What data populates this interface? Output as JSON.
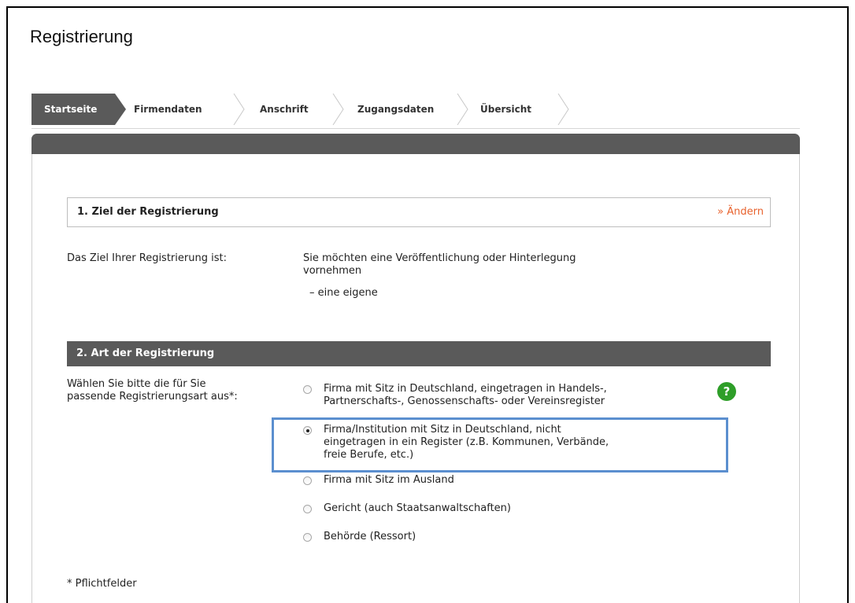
{
  "page": {
    "title": "Registrierung"
  },
  "steps": [
    {
      "label": "Startseite",
      "active": true
    },
    {
      "label": "Firmendaten",
      "active": false
    },
    {
      "label": "Anschrift",
      "active": false
    },
    {
      "label": "Zugangsdaten",
      "active": false
    },
    {
      "label": "Übersicht",
      "active": false
    }
  ],
  "section1": {
    "title": "1. Ziel der Registrierung",
    "change_label": "» Ändern",
    "goal_label": "Das Ziel Ihrer Registrierung ist:",
    "goal_value_line1": "Sie möchten eine Veröffentlichung oder Hinterlegung",
    "goal_value_line2": "vornehmen",
    "goal_sub": "– eine eigene"
  },
  "section2": {
    "title": "2. Art der Registrierung",
    "prompt_line1": "Wählen Sie bitte die für Sie",
    "prompt_line2": "passende Registrierungsart aus*:",
    "options": [
      {
        "lines": [
          "Firma mit Sitz in Deutschland, eingetragen in Handels-,",
          "Partnerschafts-, Genossenschafts- oder Vereinsregister"
        ],
        "selected": false
      },
      {
        "lines": [
          "Firma/Institution mit Sitz in Deutschland, nicht",
          "eingetragen in ein Register (z.B. Kommunen, Verbände,",
          "freie Berufe, etc.)"
        ],
        "selected": true
      },
      {
        "lines": [
          "Firma mit Sitz im Ausland"
        ],
        "selected": false
      },
      {
        "lines": [
          "Gericht (auch Staatsanwaltschaften)"
        ],
        "selected": false
      },
      {
        "lines": [
          "Behörde (Ressort)"
        ],
        "selected": false
      }
    ],
    "help_symbol": "?"
  },
  "footer": {
    "required_note": "* Pflichtfelder"
  },
  "colors": {
    "header_gray": "#5a5a5a",
    "link_orange": "#e8612c",
    "help_green": "#2e9e28",
    "highlight_blue": "#5b8fcf"
  }
}
